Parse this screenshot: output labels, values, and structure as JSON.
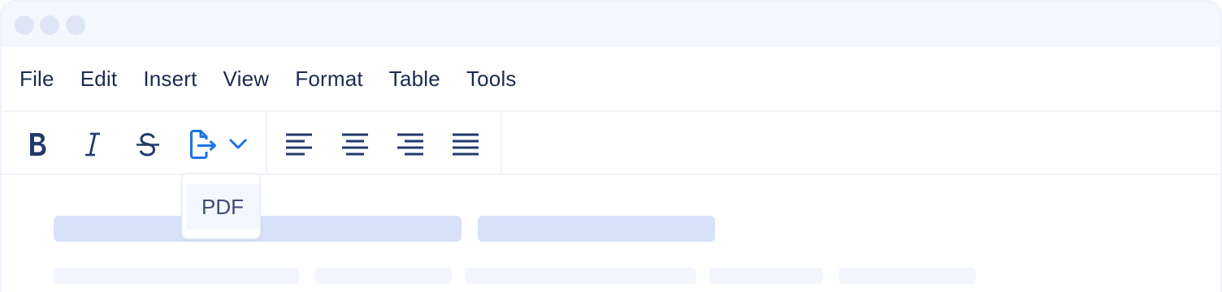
{
  "menubar": {
    "items": [
      "File",
      "Edit",
      "Insert",
      "View",
      "Format",
      "Table",
      "Tools"
    ]
  },
  "toolbar": {
    "bold_icon": "bold-icon",
    "italic_icon": "italic-icon",
    "strikethrough_icon": "strikethrough-icon",
    "export_icon": "export-icon",
    "dropdown_icon": "chevron-down-icon",
    "align_icons": [
      "align-left-icon",
      "align-center-icon",
      "align-right-icon",
      "align-justify-icon"
    ],
    "accent_color": "#1a73e8",
    "icon_color": "#213a6b"
  },
  "export_menu": {
    "items": [
      "PDF"
    ]
  }
}
